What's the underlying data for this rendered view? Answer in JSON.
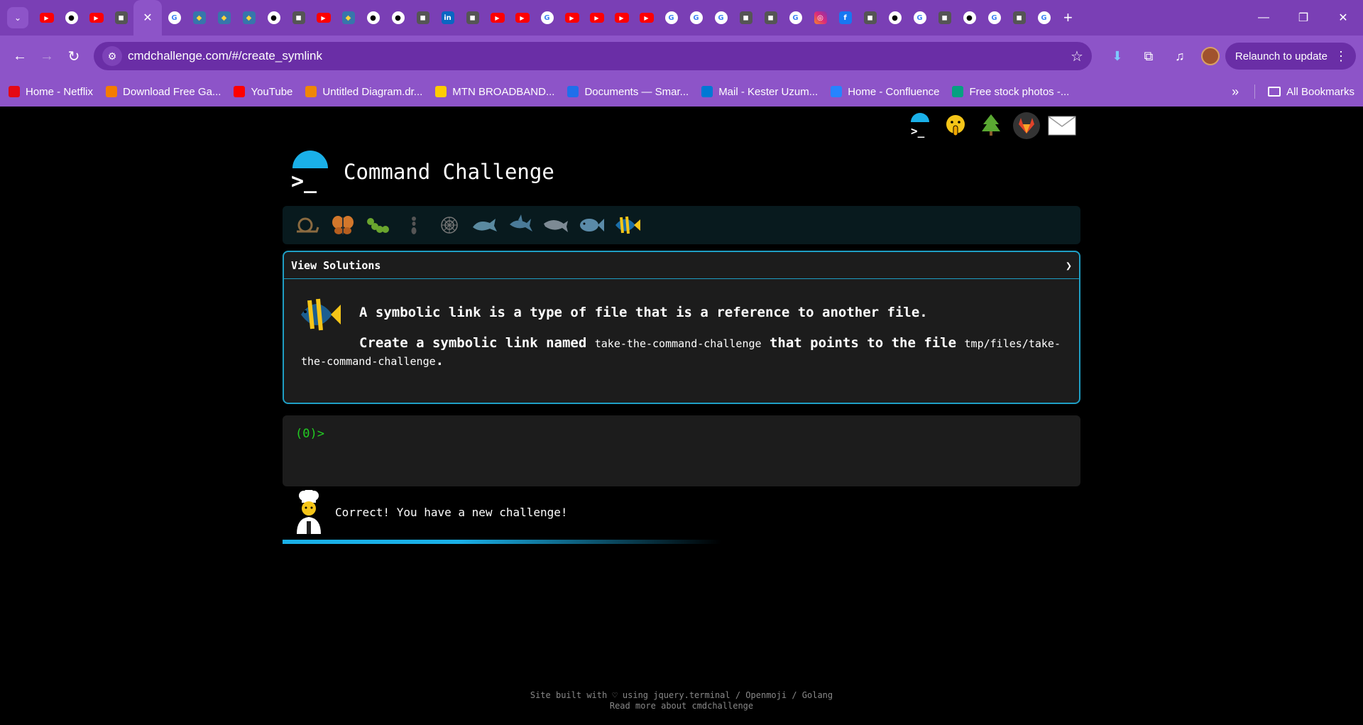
{
  "browser": {
    "url": "cmdchallenge.com/#/create_symlink",
    "relaunch_label": "Relaunch to update",
    "tab_favicons": [
      "yt",
      "gh",
      "yt",
      "misc",
      "g",
      "py",
      "py",
      "py",
      "gh",
      "misc",
      "yt",
      "py",
      "gh",
      "gh",
      "misc",
      "li",
      "misc",
      "yt",
      "yt",
      "g",
      "yt",
      "yt",
      "yt",
      "yt",
      "g",
      "g",
      "g",
      "misc",
      "misc",
      "g",
      "ig",
      "fb",
      "misc",
      "gh",
      "g",
      "misc",
      "gh",
      "g",
      "misc",
      "g"
    ],
    "bookmarks": [
      {
        "label": "Home - Netflix",
        "color": "#e50914"
      },
      {
        "label": "Download Free Ga...",
        "color": "#f57c00"
      },
      {
        "label": "YouTube",
        "color": "#ff0000"
      },
      {
        "label": "Untitled Diagram.dr...",
        "color": "#f08705"
      },
      {
        "label": "MTN BROADBAND...",
        "color": "#ffcc00"
      },
      {
        "label": "Documents — Smar...",
        "color": "#1f6feb"
      },
      {
        "label": "Mail - Kester Uzum...",
        "color": "#0078d4"
      },
      {
        "label": "Home - Confluence",
        "color": "#2684ff"
      },
      {
        "label": "Free stock photos -...",
        "color": "#05a081"
      }
    ],
    "all_bookmarks_label": "All Bookmarks"
  },
  "page": {
    "title": "Command Challenge",
    "logo_prompt": ">_",
    "solutions_label": "View Solutions",
    "challenge": {
      "line1": "A symbolic link is a type of file that is a reference to another file.",
      "line2_a": "Create a symbolic link named ",
      "line2_code1": "take-the-command-challenge",
      "line2_b": " that points to the file ",
      "line2_code2": "tmp/files/take-the-command-challenge",
      "line2_c": "."
    },
    "prompt": "(0)>",
    "feedback": "Correct! You have a new challenge!",
    "progress": 0.55,
    "footer_line1": "Site built with ♡ using jquery.terminal / Openmoji / Golang",
    "footer_line2": "Read more about cmdchallenge"
  }
}
